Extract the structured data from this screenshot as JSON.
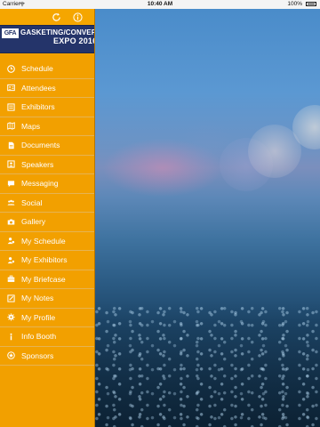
{
  "status_bar": {
    "carrier": "Carrier",
    "time": "10:40 AM",
    "battery": "100%"
  },
  "header": {
    "refresh_icon": "refresh-icon",
    "info_icon": "info-icon"
  },
  "banner": {
    "logo_mark": "GFA",
    "line1": "GASKETING/CONVERTING",
    "line2": "EXPO 2016"
  },
  "menu": [
    {
      "label": "Schedule",
      "icon": "clock-icon"
    },
    {
      "label": "Attendees",
      "icon": "attendees-icon"
    },
    {
      "label": "Exhibitors",
      "icon": "exhibitors-icon"
    },
    {
      "label": "Maps",
      "icon": "map-icon"
    },
    {
      "label": "Documents",
      "icon": "document-icon"
    },
    {
      "label": "Speakers",
      "icon": "speaker-icon"
    },
    {
      "label": "Messaging",
      "icon": "message-icon"
    },
    {
      "label": "Social",
      "icon": "social-icon"
    },
    {
      "label": "Gallery",
      "icon": "camera-icon"
    },
    {
      "label": "My Schedule",
      "icon": "user-clock-icon"
    },
    {
      "label": "My Exhibitors",
      "icon": "user-exhibitors-icon"
    },
    {
      "label": "My Briefcase",
      "icon": "briefcase-icon"
    },
    {
      "label": "My Notes",
      "icon": "notes-icon"
    },
    {
      "label": "My Profile",
      "icon": "gear-icon"
    },
    {
      "label": "Info Booth",
      "icon": "info-booth-icon"
    },
    {
      "label": "Sponsors",
      "icon": "sponsors-icon"
    }
  ],
  "colors": {
    "sidebar": "#f2a000",
    "banner": "#24346a",
    "text": "#ffffff"
  }
}
